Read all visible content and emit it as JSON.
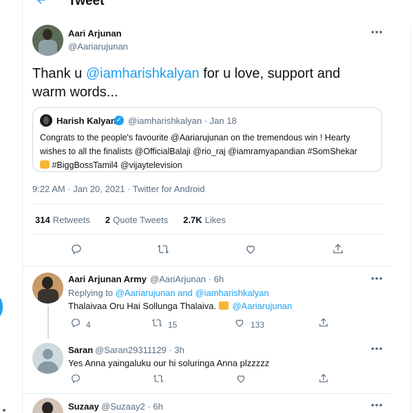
{
  "header": {
    "title": "Tweet"
  },
  "tweet": {
    "author_name": "Aari Arjunan",
    "author_handle": "@Aariarujunan",
    "text_pre": "Thank u ",
    "mention": "@iamharishkalyan",
    "text_post": " for u love, support and warm words...",
    "meta": "9:22 AM · Jan 20, 2021 · Twitter for Android",
    "quote": {
      "name": "Harish Kalyan",
      "handle_time": "@iamharishkalyan · Jan 18",
      "text": "Congrats to the people's favourite @Aariarujunan on the tremendous win ! Hearty wishes to all the finalists @OfficialBalaji @rio_raj @iamramyapandian #SomShekar",
      "text2": "#BiggBossTamil4 @vijaytelevision"
    },
    "stats": {
      "retweets": "314",
      "retweets_label": "Retweets",
      "quotes": "2",
      "quotes_label": "Quote Tweets",
      "likes": "2.7K",
      "likes_label": "Likes"
    }
  },
  "replies": [
    {
      "name": "Aari Arjunan Army",
      "handle_time": "@AariArjunan · 6h",
      "replying_label": "Replying to ",
      "replying_to": "@Aariarujunan and @iamharishkalyan",
      "text": "Thalaivaa Oru Hai Sollunga Thalaiva. ",
      "mention": "@Aariarujunan",
      "reply_count": "4",
      "retweet_count": "15",
      "like_count": "133"
    },
    {
      "name": "Saran",
      "handle_time": "@Saran29311129 · 3h",
      "text": "Yes Anna yaingaluku our hi soluringa Anna plzzzzz"
    },
    {
      "name": "Suzaay",
      "handle_time": "@Suzaay2 · 6h"
    }
  ],
  "icons": [
    "back-arrow-icon",
    "more-icon",
    "verified-icon",
    "reply-icon",
    "retweet-icon",
    "like-icon",
    "share-icon"
  ],
  "colors": {
    "accent": "#1da1f2",
    "muted": "#5b7083",
    "border": "#e6ecf0"
  }
}
